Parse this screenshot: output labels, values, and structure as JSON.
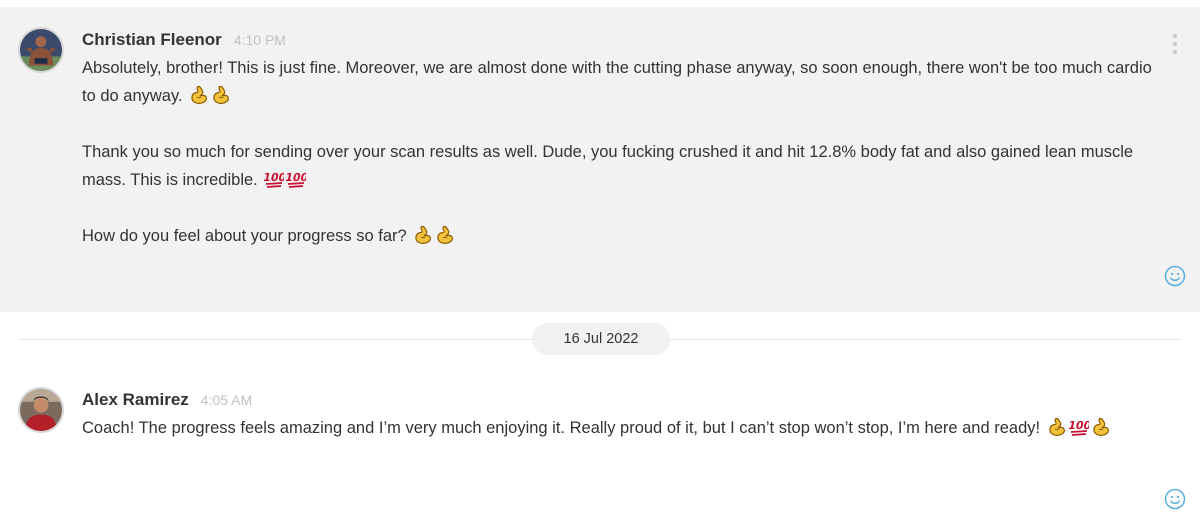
{
  "messages": [
    {
      "author": "Christian Fleenor",
      "time": "4:10 PM",
      "paragraphs": [
        "Absolutely, brother! This is just fine. Moreover, we are almost done with the cutting phase anyway, so soon enough, there won't be too much cardio to do anyway.",
        "Thank you so much for sending over your scan results as well. Dude, you fucking crushed it and hit 12.8% body fat and also gained lean muscle mass. This is incredible.",
        "How do you feel about your progress so far?"
      ],
      "emojis": [
        [
          "flexed-biceps",
          "flexed-biceps"
        ],
        [
          "hundred-points",
          "hundred-points"
        ],
        [
          "flexed-biceps",
          "flexed-biceps"
        ]
      ]
    },
    {
      "author": "Alex Ramirez",
      "time": "4:05 AM",
      "paragraphs": [
        "Coach! The progress feels amazing and I’m very much enjoying it. Really proud of it, but I can’t stop won’t stop, I’m here and ready!"
      ],
      "emojis": [
        [
          "flexed-biceps",
          "hundred-points",
          "flexed-biceps"
        ]
      ]
    }
  ],
  "date_divider": "16 Jul 2022",
  "icons": {
    "more": "vertical-ellipsis-icon",
    "react": "smiley-face-icon"
  },
  "colors": {
    "highlight_bg": "#f2f2f2",
    "react_icon": "#5aaee0",
    "timestamp": "#c2c2c2"
  }
}
